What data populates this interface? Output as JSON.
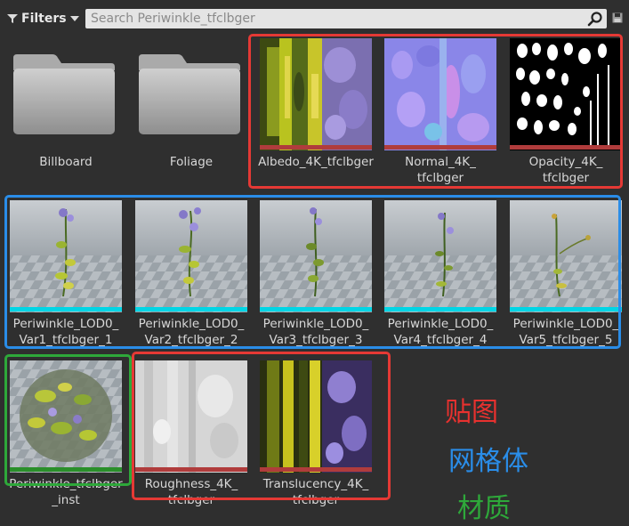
{
  "toolbar": {
    "filters_label": "Filters",
    "search_placeholder": "Search Periwinkle_tfclbger"
  },
  "assets": {
    "billboard": {
      "label": "Billboard"
    },
    "foliage": {
      "label": "Foliage"
    },
    "albedo": {
      "label": "Albedo_4K_tfclbger",
      "bar_color": "#b03c3c"
    },
    "normal": {
      "line1": "Normal_4K_",
      "line2": "tfclbger",
      "bar_color": "#b03c3c"
    },
    "opacity": {
      "line1": "Opacity_4K_",
      "line2": "tfclbger",
      "bar_color": "#b03c3c"
    },
    "mesh1": {
      "line1": "Periwinkle_LOD0_",
      "line2": "Var1_tfclbger_1",
      "bar_color": "#00d5e5"
    },
    "mesh2": {
      "line1": "Periwinkle_LOD0_",
      "line2": "Var2_tfclbger_2",
      "bar_color": "#00d5e5"
    },
    "mesh3": {
      "line1": "Periwinkle_LOD0_",
      "line2": "Var3_tfclbger_3",
      "bar_color": "#00d5e5"
    },
    "mesh4": {
      "line1": "Periwinkle_LOD0_",
      "line2": "Var4_tfclbger_4",
      "bar_color": "#00d5e5"
    },
    "mesh5": {
      "line1": "Periwinkle_LOD0_",
      "line2": "Var5_tfclbger_5",
      "bar_color": "#00d5e5"
    },
    "material": {
      "line1": "Periwinkle_tfclbger",
      "line2": "_inst",
      "bar_color": "#2a8f2a"
    },
    "roughness": {
      "line1": "Roughness_4K_",
      "line2": "tfclbger",
      "bar_color": "#b03c3c"
    },
    "translucency": {
      "line1": "Translucency_4K_",
      "line2": "tfclbger",
      "bar_color": "#b03c3c"
    }
  },
  "annotations": {
    "textures": {
      "text": "贴图",
      "color": "#e8312f"
    },
    "meshes": {
      "text": "网格体",
      "color": "#2a8de8"
    },
    "materials": {
      "text": "材质",
      "color": "#2ea83a"
    }
  },
  "colors": {
    "texture_frame": "#e53935",
    "mesh_frame": "#2a8de8",
    "material_frame": "#2ea83a"
  }
}
